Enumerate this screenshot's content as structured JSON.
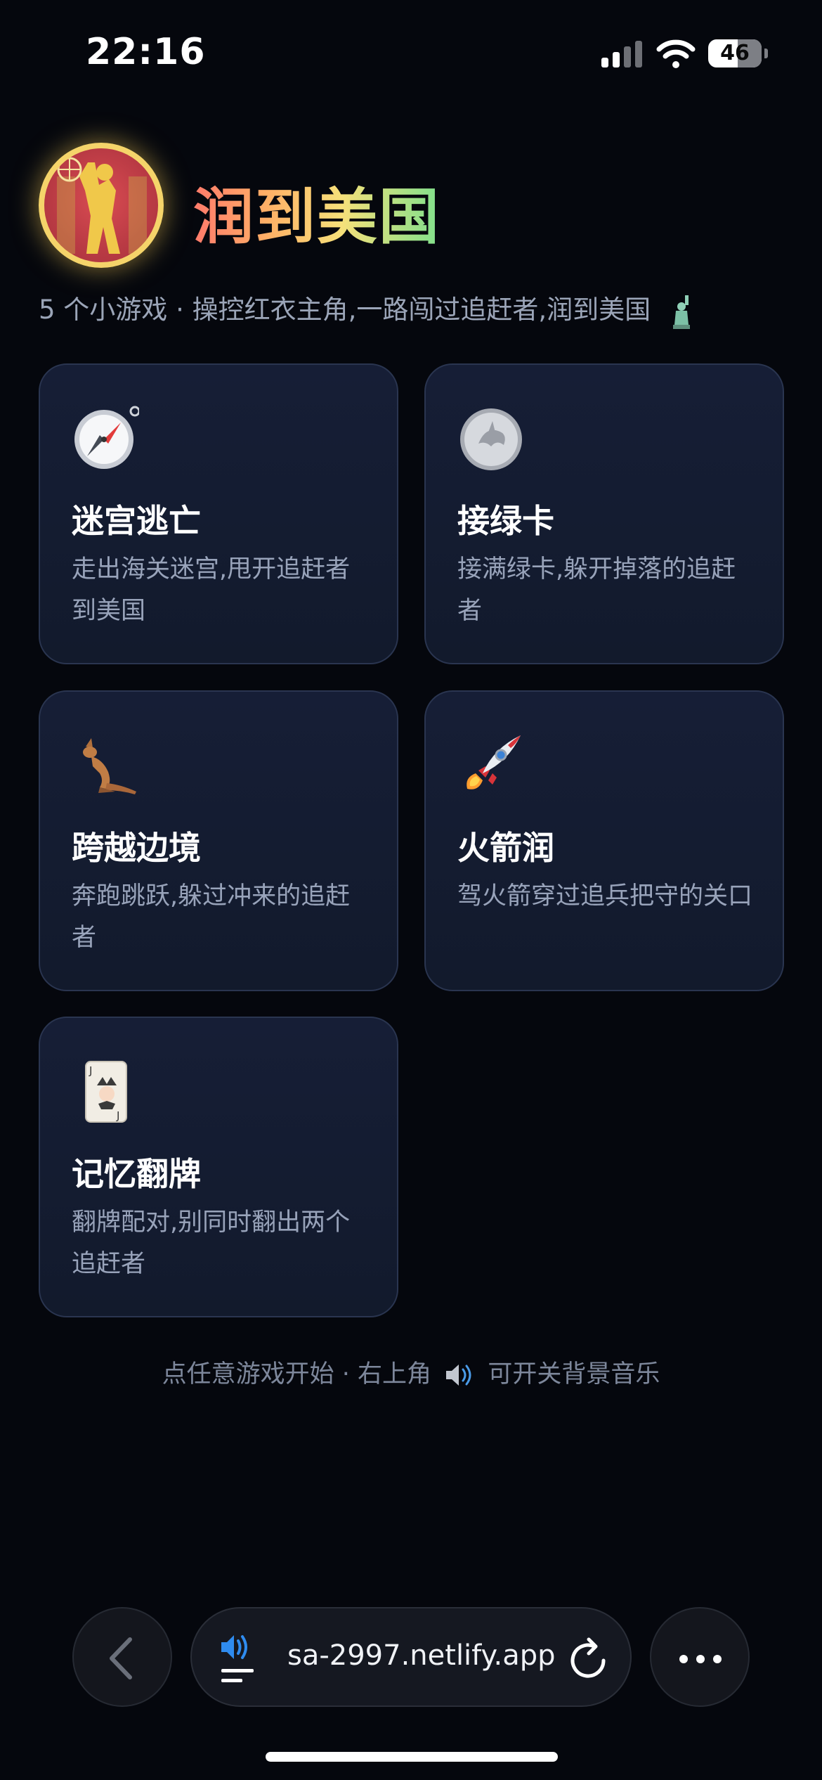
{
  "status": {
    "time": "22:16",
    "battery": "46",
    "icons": [
      "cellular-signal-icon",
      "wifi-icon",
      "battery-icon"
    ]
  },
  "header": {
    "title": "润到美国",
    "subtitle": "5 个小游戏 · 操控红衣主角,一路闯过追赶者,润到美国",
    "subtitle_icon": "statue-of-liberty-icon",
    "logo_icon": "basketball-player-logo"
  },
  "games": [
    {
      "icon": "compass-icon",
      "title": "迷宫逃亡",
      "desc": "走出海关迷宫,甩开追赶者到美国"
    },
    {
      "icon": "coin-icon",
      "title": "接绿卡",
      "desc": "接满绿卡,躲开掉落的追赶者"
    },
    {
      "icon": "kangaroo-icon",
      "title": "跨越边境",
      "desc": "奔跑跳跃,躲过冲来的追赶者"
    },
    {
      "icon": "rocket-icon",
      "title": "火箭润",
      "desc": "驾火箭穿过追兵把守的关口"
    },
    {
      "icon": "joker-card-icon",
      "title": "记忆翻牌",
      "desc": "翻牌配对,别同时翻出两个追赶者"
    }
  ],
  "hint": {
    "before": "点任意游戏开始 · 右上角",
    "icon": "speaker-icon",
    "after": "可开关背景音乐"
  },
  "browser": {
    "url": "sa-2997.netlify.app",
    "icons": [
      "back-icon",
      "page-sound-icon",
      "reload-icon",
      "more-icon"
    ]
  },
  "colors": {
    "background": "#05070d",
    "card": "#151d32",
    "card_border": "#2a3550",
    "title_gradient": [
      "#ff7a6b",
      "#ffb066",
      "#f6e07a",
      "#7fe08c"
    ],
    "logo_ring": "#f5d46a"
  }
}
